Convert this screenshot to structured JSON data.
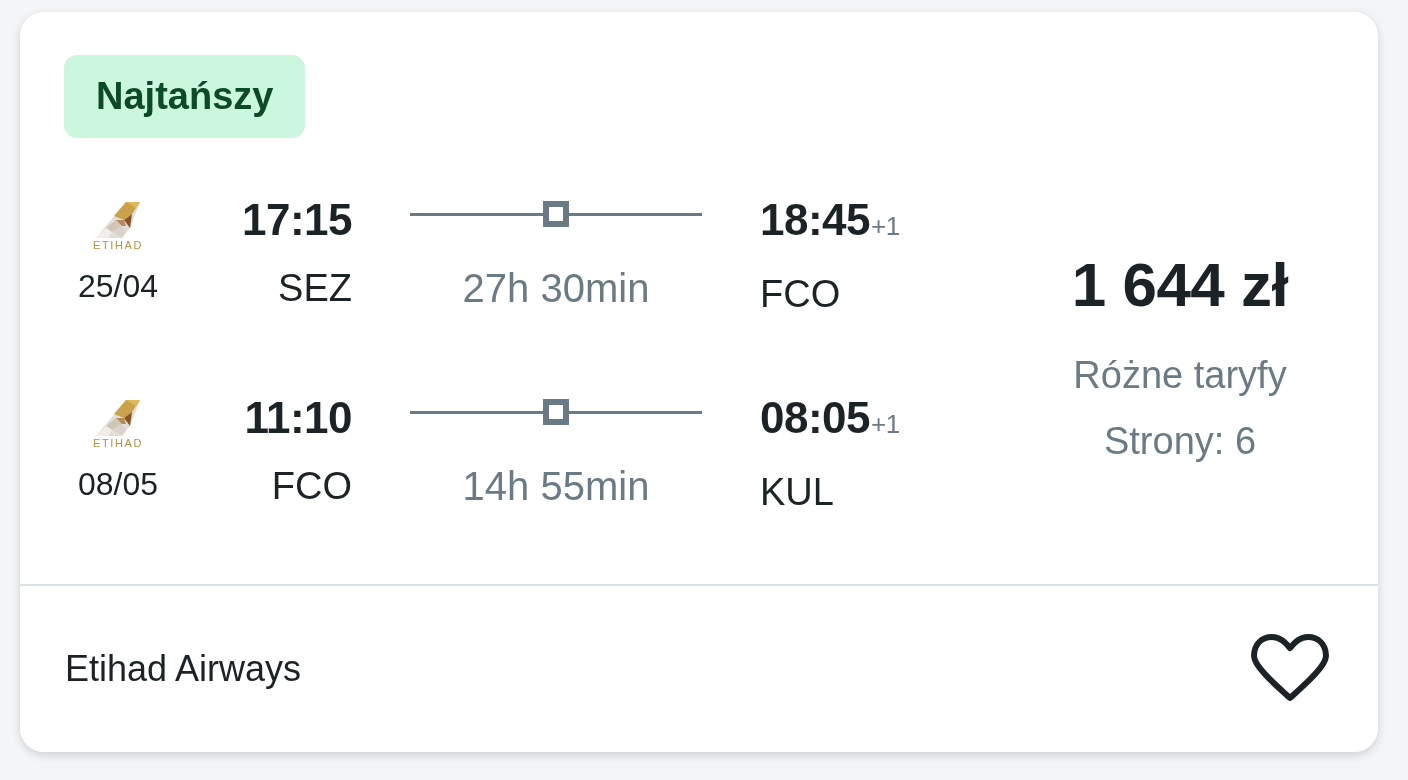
{
  "badge": {
    "label": "Najtańszy"
  },
  "legs": [
    {
      "logo_text": "ETIHAD",
      "date": "25/04",
      "departure": {
        "time": "17:15",
        "airport": "SEZ"
      },
      "nonstop": false,
      "duration": "27h 30min",
      "arrival": {
        "time": "18:45",
        "day_offset": "+1",
        "airport": "FCO"
      }
    },
    {
      "logo_text": "ETIHAD",
      "date": "08/05",
      "departure": {
        "time": "11:10",
        "airport": "FCO"
      },
      "nonstop": false,
      "duration": "14h 55min",
      "arrival": {
        "time": "08:05",
        "day_offset": "+1",
        "airport": "KUL"
      }
    }
  ],
  "price": {
    "amount": "1 644 zł",
    "fare_note": "Różne taryfy",
    "sites": "Strony: 6"
  },
  "footer": {
    "airline": "Etihad Airways",
    "favorite": false
  }
}
